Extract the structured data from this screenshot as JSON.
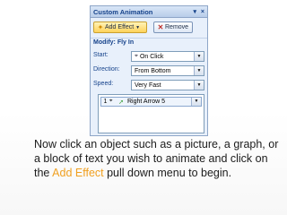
{
  "pane": {
    "title": "Custom Animation",
    "title_controls": [
      "▾",
      "×"
    ],
    "add_effect_label": "Add Effect",
    "remove_label": "Remove",
    "modify_heading": "Modify: Fly In",
    "start": {
      "label": "Start:",
      "value": "On Click"
    },
    "direction": {
      "label": "Direction:",
      "value": "From Bottom"
    },
    "speed": {
      "label": "Speed:",
      "value": "Very Fast"
    },
    "list_item": {
      "order": "1",
      "name": "Right Arrow 5"
    }
  },
  "caption": {
    "text_before": "Now click an object such as a picture, a graph, or a block of text you wish to animate and click on the ",
    "highlight": "Add Effect",
    "text_after": " pull down menu to begin."
  },
  "colors": {
    "highlight": "#f0a020",
    "pane_bg": "#e8f0fb",
    "pane_title": "#15428b"
  },
  "icons": [
    "star-icon",
    "remove-x-icon",
    "dropdown-arrow-icon",
    "clock-icon",
    "mouse-icon",
    "green-arrow-icon"
  ]
}
